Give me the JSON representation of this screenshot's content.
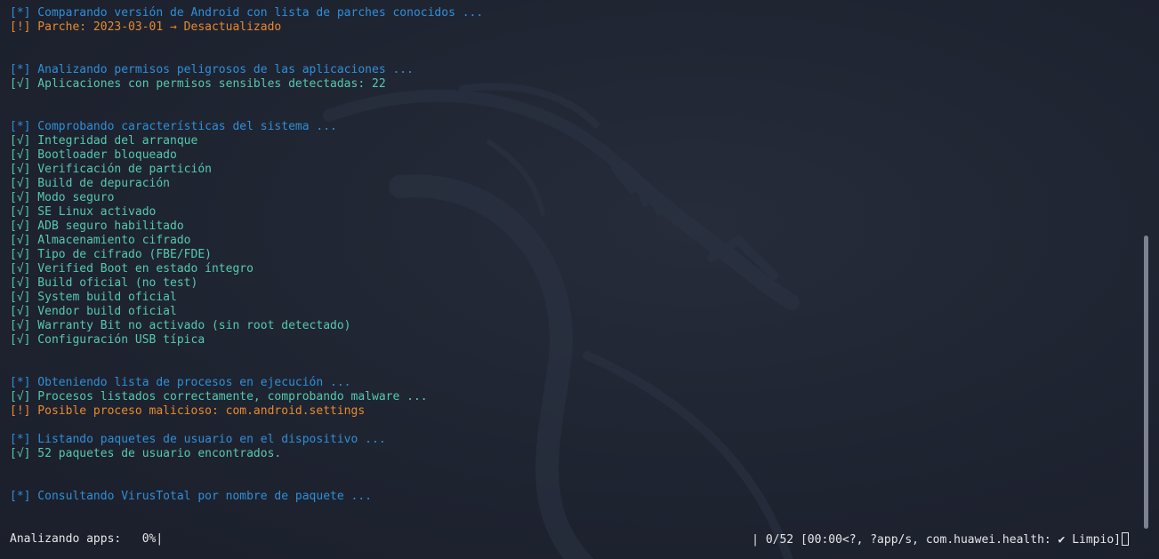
{
  "terminal": {
    "lines": [
      {
        "type": "info",
        "text": "[*] Comparando versión de Android con lista de parches conocidos ..."
      },
      {
        "type": "warn",
        "text": "[!] Parche: 2023-03-01 → Desactualizado"
      },
      {
        "type": "blank",
        "text": ""
      },
      {
        "type": "blank",
        "text": ""
      },
      {
        "type": "info",
        "text": "[*] Analizando permisos peligrosos de las aplicaciones ..."
      },
      {
        "type": "ok",
        "text": "[√] Aplicaciones con permisos sensibles detectadas: 22"
      },
      {
        "type": "blank",
        "text": ""
      },
      {
        "type": "blank",
        "text": ""
      },
      {
        "type": "info",
        "text": "[*] Comprobando características del sistema ..."
      },
      {
        "type": "ok",
        "text": "[√] Integridad del arranque"
      },
      {
        "type": "ok",
        "text": "[√] Bootloader bloqueado"
      },
      {
        "type": "ok",
        "text": "[√] Verificación de partición"
      },
      {
        "type": "ok",
        "text": "[√] Build de depuración"
      },
      {
        "type": "ok",
        "text": "[√] Modo seguro"
      },
      {
        "type": "ok",
        "text": "[√] SE Linux activado"
      },
      {
        "type": "ok",
        "text": "[√] ADB seguro habilitado"
      },
      {
        "type": "ok",
        "text": "[√] Almacenamiento cifrado"
      },
      {
        "type": "ok",
        "text": "[√] Tipo de cifrado (FBE/FDE)"
      },
      {
        "type": "ok",
        "text": "[√] Verified Boot en estado íntegro"
      },
      {
        "type": "ok",
        "text": "[√] Build oficial (no test)"
      },
      {
        "type": "ok",
        "text": "[√] System build oficial"
      },
      {
        "type": "ok",
        "text": "[√] Vendor build oficial"
      },
      {
        "type": "ok",
        "text": "[√] Warranty Bit no activado (sin root detectado)"
      },
      {
        "type": "ok",
        "text": "[√] Configuración USB típica"
      },
      {
        "type": "blank",
        "text": ""
      },
      {
        "type": "blank",
        "text": ""
      },
      {
        "type": "info",
        "text": "[*] Obteniendo lista de procesos en ejecución ..."
      },
      {
        "type": "ok",
        "text": "[√] Procesos listados correctamente, comprobando malware ..."
      },
      {
        "type": "warn",
        "text": "[!] Posible proceso malicioso: com.android.settings"
      },
      {
        "type": "blank",
        "text": ""
      },
      {
        "type": "info",
        "text": "[*] Listando paquetes de usuario en el dispositivo ..."
      },
      {
        "type": "ok",
        "text": "[√] 52 paquetes de usuario encontrados."
      },
      {
        "type": "blank",
        "text": ""
      },
      {
        "type": "blank",
        "text": ""
      },
      {
        "type": "info",
        "text": "[*] Consultando VirusTotal por nombre de paquete ..."
      }
    ]
  },
  "progress": {
    "label": "Analizando apps:   0%|",
    "percent": 0,
    "detail": "| 0/52 [00:00<?, ?app/s, com.huawei.health: ✔ Limpio]"
  },
  "colors": {
    "background": "#1e2330",
    "info": "#2f8fd8",
    "ok": "#56c9b0",
    "warn": "#e88a2e"
  },
  "icons": {
    "background": "kali-dragon-icon"
  }
}
